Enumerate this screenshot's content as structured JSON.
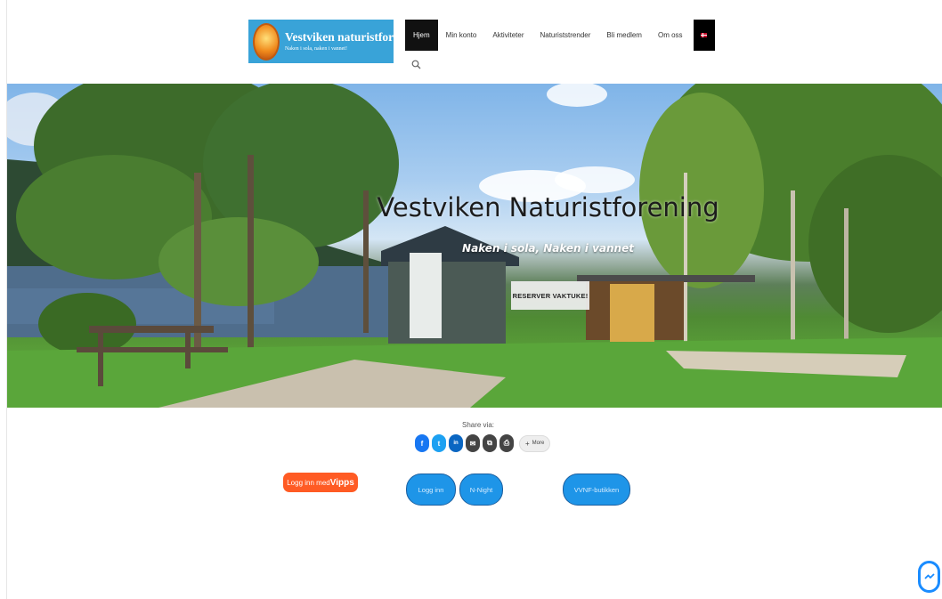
{
  "header": {
    "logo": {
      "title": "Vestviken naturistforening",
      "tagline": "Naken i sola, naken i vannet!"
    },
    "nav": [
      {
        "label": "Hjem",
        "active": true
      },
      {
        "label": "Min konto",
        "active": false
      },
      {
        "label": "Aktiviteter",
        "active": false
      },
      {
        "label": "Naturiststrender",
        "active": false
      },
      {
        "label": "Bli medlem",
        "active": false
      },
      {
        "label": "Om oss",
        "active": false
      }
    ],
    "language_flag": "norway-flag-icon",
    "search_icon": "search-icon"
  },
  "hero": {
    "title": "Vestviken Naturistforening",
    "subtitle": "Naken i sola, Naken i vannet",
    "button_label": "RESERVER VAKTUKE!"
  },
  "share": {
    "label": "Share via:",
    "buttons": [
      {
        "name": "facebook",
        "glyph": "f",
        "color": "#1877f2"
      },
      {
        "name": "twitter",
        "glyph": "t",
        "color": "#1da1f2"
      },
      {
        "name": "linkedin",
        "glyph": "in",
        "color": "#0a66c2"
      },
      {
        "name": "email",
        "glyph": "✉",
        "color": "#444444"
      },
      {
        "name": "copy",
        "glyph": "⧉",
        "color": "#444444"
      },
      {
        "name": "print",
        "glyph": "⎙",
        "color": "#444444"
      }
    ],
    "more_label": "More",
    "more_glyph": "+"
  },
  "actions": {
    "vipps_prefix": "Logg inn med",
    "vipps_brand": "Vipps",
    "login_label": "Logg inn",
    "night_label": "N-Night",
    "shop_label": "VVNF-butikken"
  },
  "colors": {
    "vipps": "#ff5b24",
    "pill": "#1e95e8",
    "logo_bg": "#39a3d8",
    "nav_active": "#111111"
  }
}
